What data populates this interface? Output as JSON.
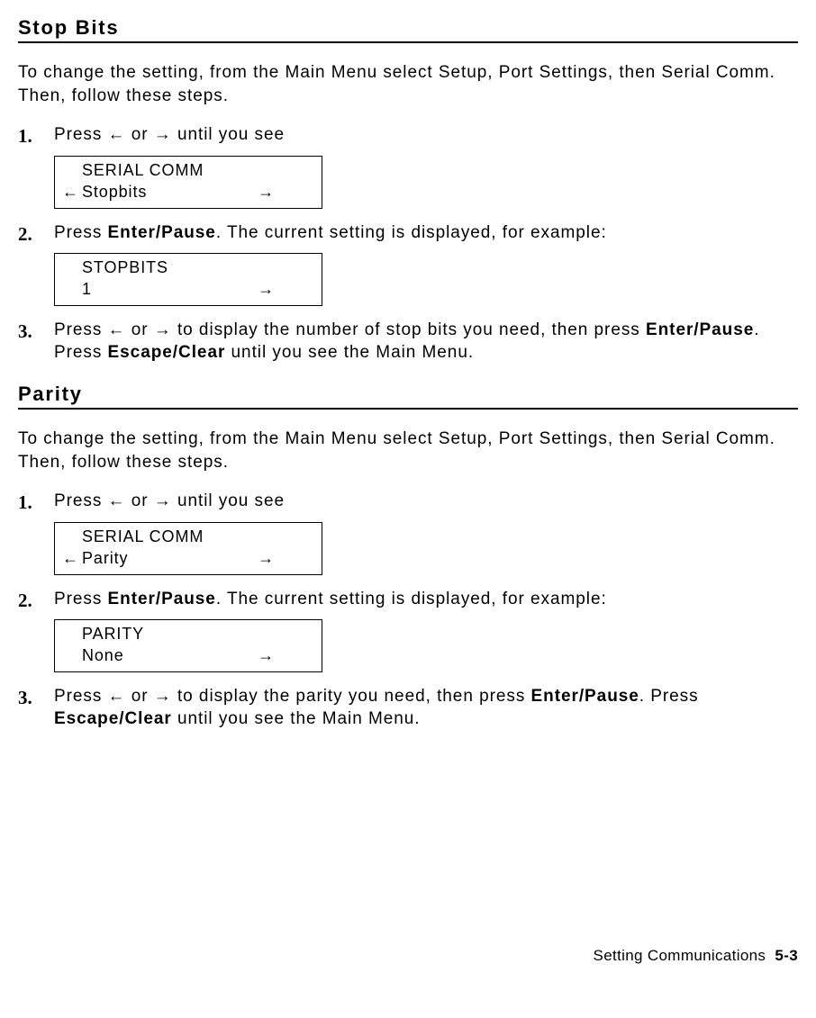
{
  "arrows": {
    "left": "←",
    "right": "→"
  },
  "sections": {
    "stopbits": {
      "title": "Stop Bits",
      "intro": "To change the setting, from the Main Menu select Setup, Port Settings, then Serial Comm.  Then, follow these steps.",
      "step1_pre": "Press ",
      "step1_or": " or ",
      "step1_post": " until you see",
      "display1": {
        "line1": "SERIAL COMM",
        "line2": "Stopbits",
        "showLeft": true
      },
      "step2_pre": "Press ",
      "step2_kw": "Enter/Pause",
      "step2_post": ".  The current setting is displayed, for example:",
      "display2": {
        "line1": "STOPBITS",
        "line2": "1",
        "showLeft": false
      },
      "step3_pre": "Press ",
      "step3_or": " or ",
      "step3_mid": " to display the number of stop bits you need, then press ",
      "step3_kw1": "Enter/Pause",
      "step3_mid2": ".  Press ",
      "step3_kw2": "Escape/Clear",
      "step3_post": " until you see the Main Menu."
    },
    "parity": {
      "title": "Parity",
      "intro": "To change the setting, from the Main Menu select Setup, Port Settings, then Serial Comm.  Then, follow these steps.",
      "step1_pre": "Press ",
      "step1_or": " or ",
      "step1_post": " until you see",
      "display1": {
        "line1": "SERIAL COMM",
        "line2": "Parity",
        "showLeft": true
      },
      "step2_pre": "Press ",
      "step2_kw": "Enter/Pause",
      "step2_post": ".  The current setting is displayed, for example:",
      "display2": {
        "line1": "PARITY",
        "line2": "None",
        "showLeft": false
      },
      "step3_pre": "Press ",
      "step3_or": " or ",
      "step3_mid": " to display the parity you need, then press ",
      "step3_kw1": "Enter/Pause",
      "step3_mid2": ". Press ",
      "step3_kw2": "Escape/Clear",
      "step3_post": " until you see the Main Menu."
    }
  },
  "footer": {
    "label": "Setting Communications",
    "page": "5-3"
  }
}
